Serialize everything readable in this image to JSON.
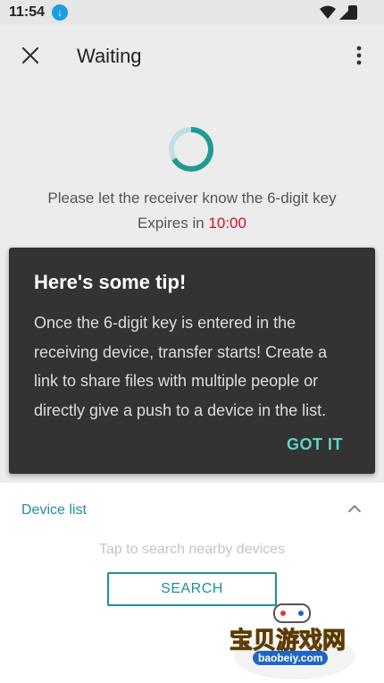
{
  "status_bar": {
    "time": "11:54"
  },
  "app_bar": {
    "title": "Waiting"
  },
  "waiting": {
    "prompt": "Please let the receiver know the 6-digit key",
    "expires_label": "Expires in",
    "expires_time": "10:00"
  },
  "tip": {
    "title": "Here's some tip!",
    "body": "Once the 6-digit key is entered in the receiving device, transfer starts! Create a link to share files with multiple people or directly give a push to a device in the list.",
    "action": "GOT IT"
  },
  "device_list": {
    "title": "Device list",
    "hint": "Tap to search nearby devices",
    "search_label": "SEARCH"
  },
  "watermark": {
    "text": "宝贝游戏网",
    "url": "baobeiy.com"
  },
  "colors": {
    "accent": "#1f8f9f",
    "expires_time": "#c8102e",
    "tip_background": "#333333",
    "tip_action": "#5fd4c0"
  }
}
